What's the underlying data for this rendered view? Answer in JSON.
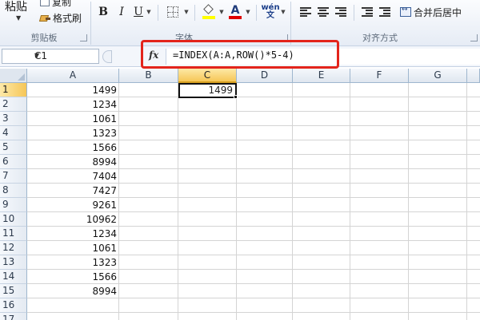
{
  "ribbon": {
    "clipboard": {
      "paste_label": "粘贴",
      "copy_label": "复制",
      "format_painter_label": "格式刷",
      "group_label": "剪贴板"
    },
    "font": {
      "bold_label": "B",
      "italic_label": "I",
      "underline_label": "U",
      "font_color_glyph": "A",
      "wen_glyph": "wén\n文",
      "group_label": "字体",
      "fill_color": "#ffff00",
      "font_color": "#e00000"
    },
    "alignment": {
      "merge_label": "合并后居中",
      "group_label": "对齐方式"
    }
  },
  "formula_bar": {
    "name_box": "C1",
    "fx_label": "fx",
    "formula": "=INDEX(A:A,ROW()*5-4)",
    "highlight_color": "#e3241b"
  },
  "sheet": {
    "columns": [
      "A",
      "B",
      "C",
      "D",
      "E",
      "F",
      "G"
    ],
    "active_column": "C",
    "rows": [
      "1",
      "2",
      "3",
      "4",
      "5",
      "6",
      "7",
      "8",
      "9",
      "10",
      "11",
      "12",
      "13",
      "14",
      "15",
      "16",
      "17"
    ],
    "active_row": "1",
    "column_a_values": [
      "1499",
      "1234",
      "1061",
      "1323",
      "1566",
      "8994",
      "7404",
      "7427",
      "9261",
      "10962",
      "1234",
      "1061",
      "1323",
      "1566",
      "8994"
    ],
    "c1_value": "1499"
  }
}
